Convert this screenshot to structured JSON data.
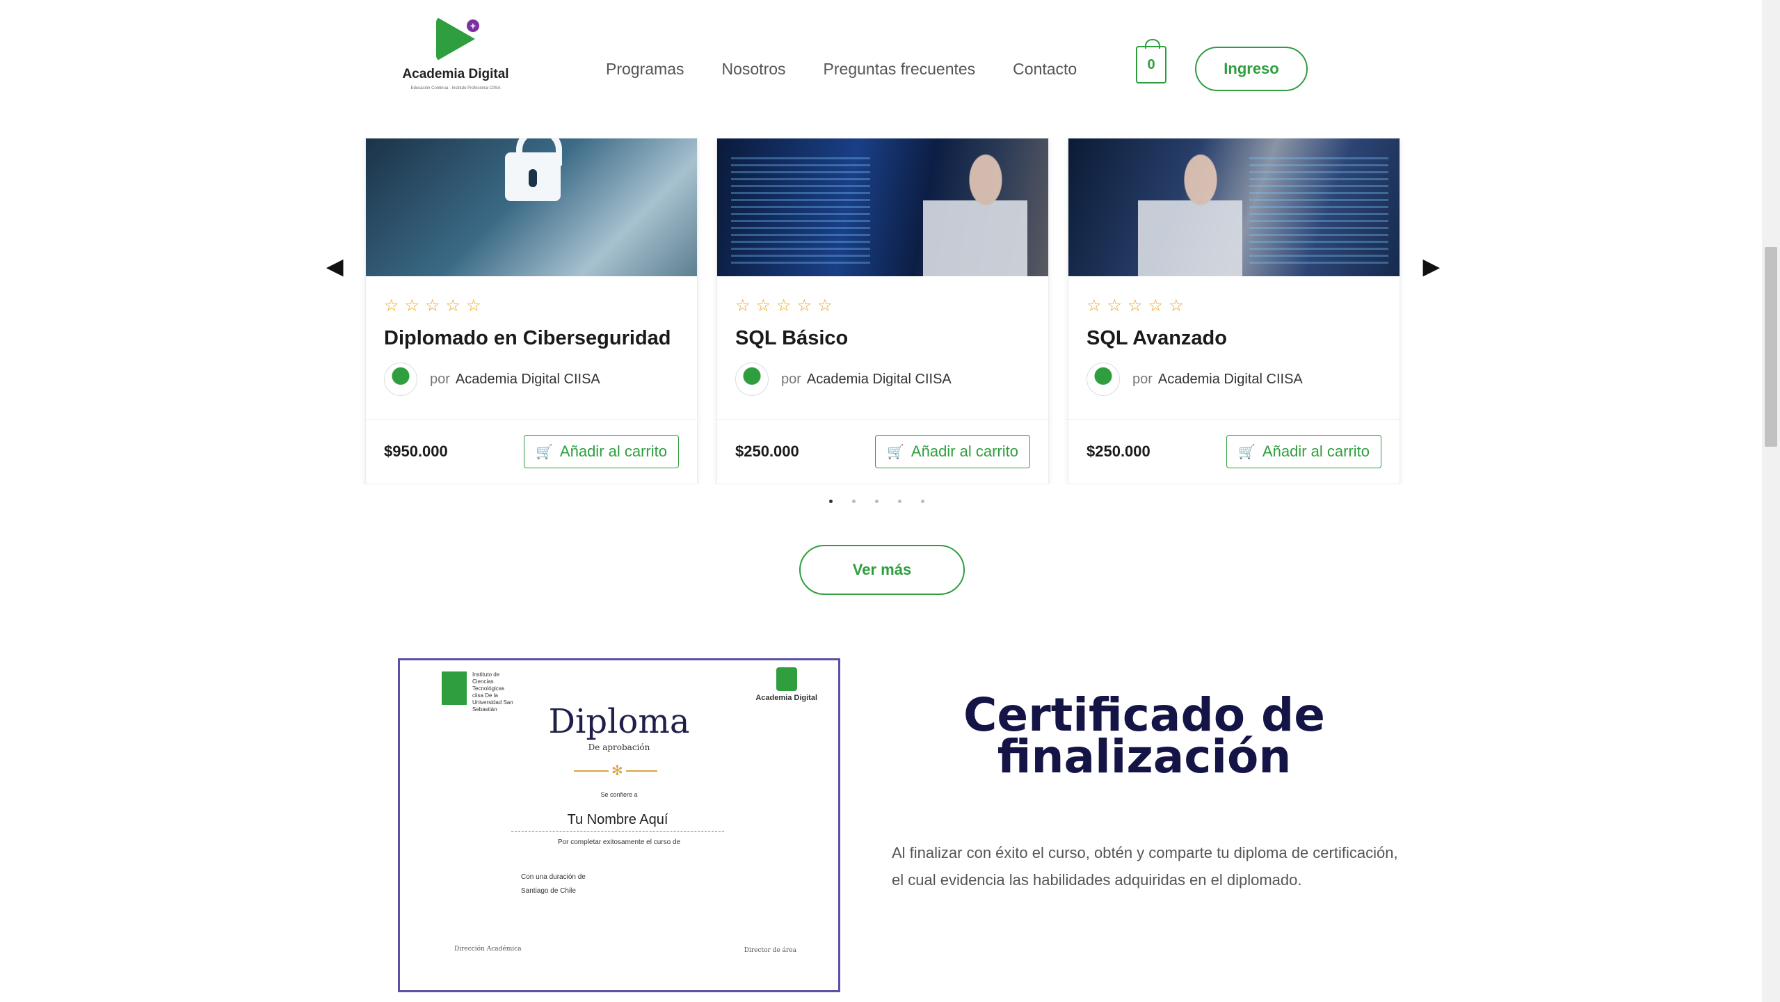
{
  "brand": {
    "name": "Academia Digital",
    "tagline": "Educación Continua - Instituto Profesional CIISA"
  },
  "nav": {
    "items": [
      "Programas",
      "Nosotros",
      "Preguntas frecuentes",
      "Contacto"
    ]
  },
  "cart": {
    "count": "0"
  },
  "login_label": "Ingreso",
  "courses": [
    {
      "title": "Diplomado en Ciberseguridad",
      "por": "por",
      "author": "Academia Digital CIISA",
      "price": "$950.000",
      "button": "Añadir al carrito",
      "rating": 0
    },
    {
      "title": "SQL Básico",
      "por": "por",
      "author": "Academia Digital CIISA",
      "price": "$250.000",
      "button": "Añadir al carrito",
      "rating": 0
    },
    {
      "title": "SQL Avanzado",
      "por": "por",
      "author": "Academia Digital CIISA",
      "price": "$250.000",
      "button": "Añadir al carrito",
      "rating": 0
    }
  ],
  "carousel": {
    "pages": 5,
    "active_page": 1
  },
  "ver_mas": "Ver más",
  "diploma": {
    "institute": "Instituto de Ciencias Tecnológicas ciisa De la Universidad San Sebastián",
    "logo_name": "Academia Digital",
    "title": "Diploma",
    "subtitle": "De aprobación",
    "conferred": "Se confiere a",
    "name": "Tu Nombre Aquí",
    "completion": "Por completar exitosamente el curso de",
    "duration": "Con una duración de",
    "city": "Santiago de Chile",
    "sign_left": "Dirección Académica",
    "sign_right": "Director de área"
  },
  "certificate": {
    "title_line1": "Certificado de",
    "title_line2": "finalización",
    "text": "Al finalizar con éxito el curso, obtén y comparte tu diploma de certificación, el cual evidencia las habilidades adquiridas en el diplomado."
  },
  "colors": {
    "accent": "#2e9e3e",
    "heading": "#141446",
    "star": "#e8a317"
  }
}
